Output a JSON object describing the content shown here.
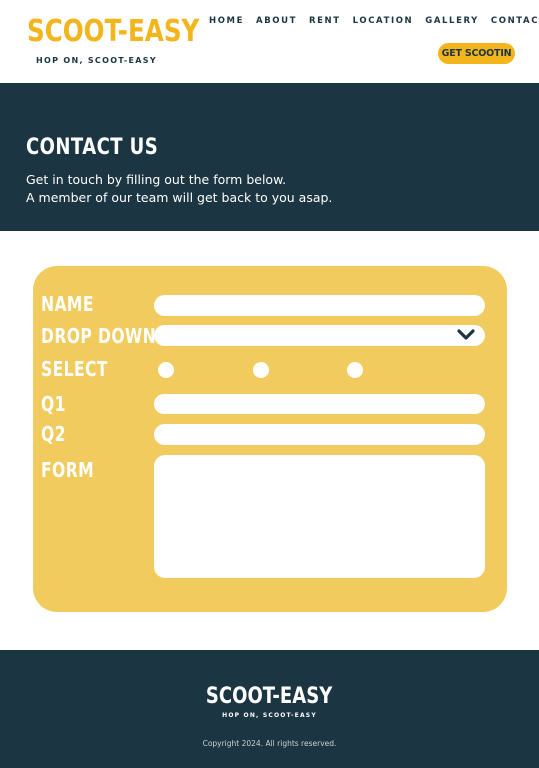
{
  "colors": {
    "brand_yellow": "#f2b51b",
    "card_yellow": "#f2cb5e",
    "navy": "#1b3542",
    "white": "#ffffff"
  },
  "header": {
    "logo": "SCOOT-EASY",
    "tagline": "HOP ON, SCOOT-EASY",
    "nav": [
      "HOME",
      "ABOUT",
      "RENT",
      "LOCATION",
      "GALLERY",
      "CONTACT"
    ],
    "cta": "GET SCOOTIN"
  },
  "hero": {
    "title": "CONTACT US",
    "line1": "Get in touch by filling out the form below.",
    "line2": "A member of our team will get back to you asap."
  },
  "form": {
    "name_label": "NAME",
    "dropdown_label": "DROP DOWN",
    "select_label": "SELECT",
    "q1_label": "Q1",
    "q2_label": "Q2",
    "form_label": "FORM",
    "dropdown_icon": "chevron-down-icon"
  },
  "footer": {
    "logo": "SCOOT-EASY",
    "tagline": "HOP ON, SCOOT-EASY",
    "copyright": "Copyright 2024. All rights reserved."
  }
}
